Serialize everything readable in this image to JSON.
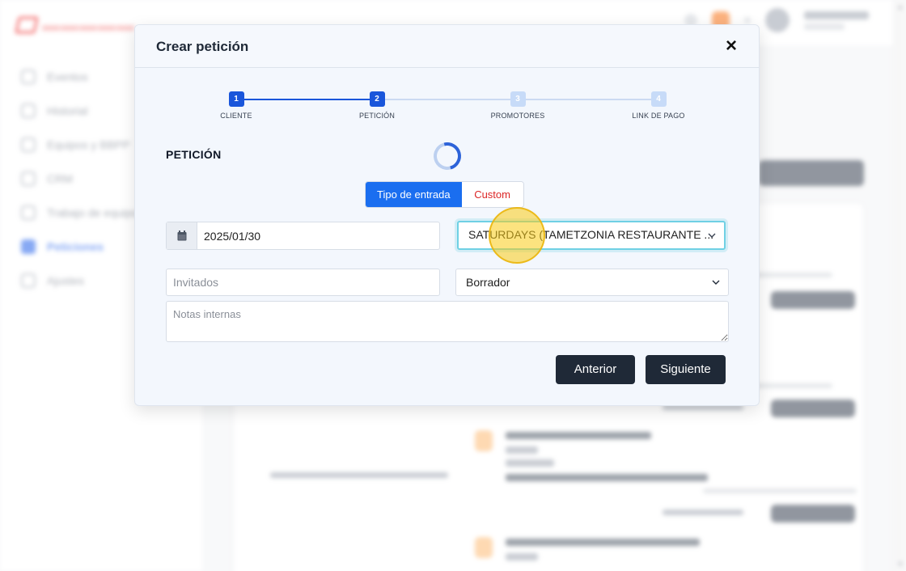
{
  "background": {
    "nav_items": [
      "Eventos",
      "Historial",
      "Equipos y BBPP",
      "CRM",
      "Trabajo de equipo",
      "Peticiones",
      "Ajustes"
    ],
    "active_nav_index": 5
  },
  "modal": {
    "title": "Crear petición",
    "close_symbol": "×",
    "steps": [
      {
        "number": "1",
        "label": "CLIENTE",
        "state": "done"
      },
      {
        "number": "2",
        "label": "PETICIÓN",
        "state": "current"
      },
      {
        "number": "3",
        "label": "PROMOTORES",
        "state": "pending"
      },
      {
        "number": "4",
        "label": "LINK DE PAGO",
        "state": "pending"
      }
    ],
    "section_title": "PETICIÓN",
    "segment": {
      "ticket_type": "Tipo de entrada",
      "custom": "Custom",
      "selected": "ticket_type"
    },
    "date_value": "2025/01/30",
    "event_select_value": "SATURDAYS (TAMETZONIA RESTAURANTE ...",
    "guests_placeholder": "Invitados",
    "status_select_value": "Borrador",
    "notes_placeholder": "Notas internas",
    "prev_button": "Anterior",
    "next_button": "Siguiente"
  },
  "colors": {
    "primary": "#1a6ef0",
    "step_done": "#1a56db",
    "step_pending": "#c7dbf8",
    "custom_text": "#dc2626",
    "dark_button": "#1f2937",
    "focus_ring": "#6fd0e4",
    "click_highlight": "#facc15"
  }
}
